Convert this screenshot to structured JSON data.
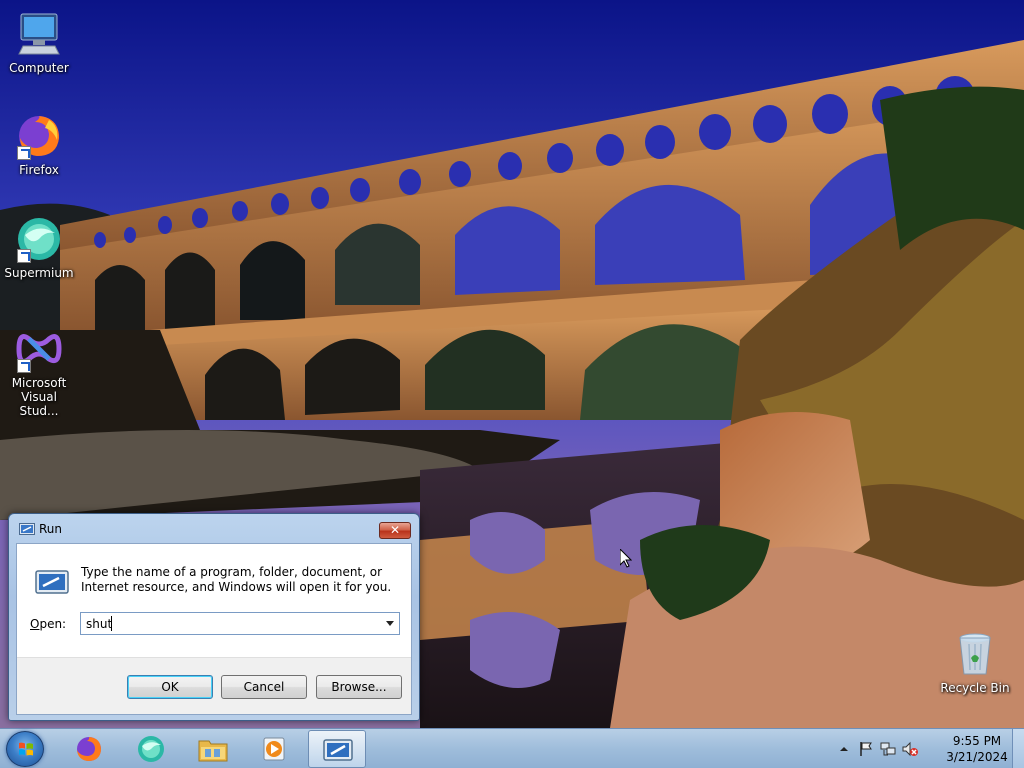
{
  "desktop": {
    "icons": [
      {
        "label": "Computer",
        "icon": "computer-icon"
      },
      {
        "label": "Firefox",
        "icon": "firefox-icon"
      },
      {
        "label": "Supermium",
        "icon": "supermium-icon"
      },
      {
        "label": "Microsoft Visual Stud...",
        "icon": "visual-studio-icon"
      }
    ],
    "recycle_bin": {
      "label": "Recycle Bin",
      "icon": "recycle-bin-icon"
    }
  },
  "run_dialog": {
    "title": "Run",
    "description": "Type the name of a program, folder, document, or Internet resource, and Windows will open it for you.",
    "open_label_prefix": "O",
    "open_label_rest": "pen:",
    "open_value": "shut",
    "close_glyph": "✕",
    "buttons": {
      "ok": "OK",
      "cancel": "Cancel",
      "browse": "Browse..."
    }
  },
  "taskbar": {
    "items": [
      {
        "name": "firefox",
        "icon": "firefox-icon"
      },
      {
        "name": "supermium",
        "icon": "supermium-icon"
      },
      {
        "name": "file-explorer",
        "icon": "folder-icon"
      },
      {
        "name": "media-player",
        "icon": "media-player-icon"
      },
      {
        "name": "run",
        "icon": "run-icon",
        "active": true
      }
    ],
    "tray": {
      "time": "9:55 PM",
      "date": "3/21/2024"
    }
  },
  "colors": {
    "taskbar": "#9fbddb",
    "dialog_frame": "#a9c3e4",
    "close_button": "#c8432a",
    "accent": "#3c7fb1"
  }
}
